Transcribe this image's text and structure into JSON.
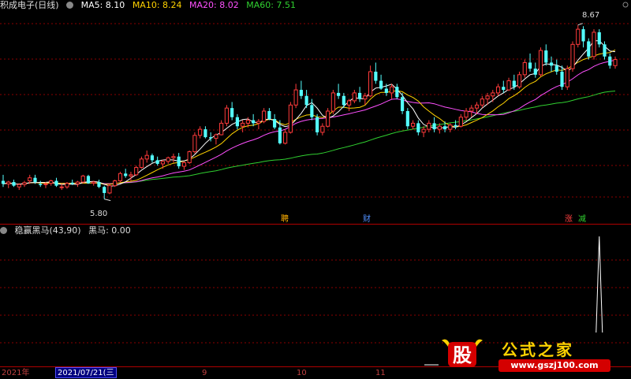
{
  "header": {
    "title": "积成电子(日线)",
    "ma5": "MA5: 8.10",
    "ma10": "MA10: 8.24",
    "ma20": "MA20: 8.02",
    "ma60": "MA60: 7.51"
  },
  "sub_header": {
    "title": "稳赢黑马(43,90)",
    "value": "黑马: 0.00"
  },
  "annotations": {
    "high": "8.67",
    "low": "5.80",
    "tag_1": "聘",
    "tag_2": "财",
    "tag_3": "涨",
    "tag_4": "减"
  },
  "x_axis": {
    "year": "2021年",
    "selected_date": "2021/07/21(三",
    "month_9": "9",
    "month_10": "10",
    "month_11": "11"
  },
  "watermark": {
    "logo_char": "股",
    "text": "公式之家",
    "url": "www.gszj100.com"
  },
  "colors": {
    "up": "#ff3b3b",
    "down": "#54ffff",
    "ma5": "#ffffff",
    "ma10": "#ffd200",
    "ma20": "#ff50ff",
    "ma60": "#30d030",
    "grid": "#8b0000",
    "indicator": "#ffffff"
  },
  "chart_data": {
    "type": "candlestick",
    "title": "积成电子(日线)",
    "ylim": [
      5.6,
      8.9
    ],
    "high_label": 8.67,
    "low_label": 5.8,
    "ohlc": [
      [
        6.1,
        6.2,
        6.0,
        6.05
      ],
      [
        6.05,
        6.1,
        5.98,
        6.08
      ],
      [
        6.08,
        6.12,
        6.0,
        6.02
      ],
      [
        6.0,
        6.06,
        5.95,
        6.04
      ],
      [
        6.04,
        6.1,
        6.0,
        6.07
      ],
      [
        6.1,
        6.2,
        6.05,
        6.15
      ],
      [
        6.15,
        6.2,
        6.05,
        6.08
      ],
      [
        6.05,
        6.1,
        6.0,
        6.03
      ],
      [
        6.04,
        6.08,
        5.98,
        6.05
      ],
      [
        6.06,
        6.12,
        6.02,
        6.1
      ],
      [
        6.1,
        6.15,
        6.0,
        6.02
      ],
      [
        6.0,
        6.05,
        5.95,
        6.0
      ],
      [
        6.0,
        6.08,
        5.97,
        6.06
      ],
      [
        6.07,
        6.12,
        6.03,
        6.05
      ],
      [
        6.05,
        6.1,
        6.0,
        6.08
      ],
      [
        6.08,
        6.2,
        6.06,
        6.18
      ],
      [
        6.18,
        6.2,
        6.05,
        6.06
      ],
      [
        6.06,
        6.1,
        6.02,
        6.08
      ],
      [
        6.08,
        6.12,
        5.98,
        6.0
      ],
      [
        6.0,
        6.02,
        5.8,
        5.9
      ],
      [
        5.9,
        6.05,
        5.88,
        6.02
      ],
      [
        6.02,
        6.12,
        6.0,
        6.1
      ],
      [
        6.1,
        6.25,
        6.08,
        6.22
      ],
      [
        6.22,
        6.3,
        6.15,
        6.18
      ],
      [
        6.18,
        6.25,
        6.1,
        6.2
      ],
      [
        6.2,
        6.35,
        6.18,
        6.32
      ],
      [
        6.32,
        6.5,
        6.3,
        6.46
      ],
      [
        6.46,
        6.6,
        6.4,
        6.52
      ],
      [
        6.52,
        6.55,
        6.4,
        6.44
      ],
      [
        6.44,
        6.5,
        6.35,
        6.38
      ],
      [
        6.38,
        6.45,
        6.3,
        6.42
      ],
      [
        6.42,
        6.5,
        6.38,
        6.48
      ],
      [
        6.48,
        6.55,
        6.4,
        6.5
      ],
      [
        6.5,
        6.56,
        6.3,
        6.34
      ],
      [
        6.34,
        6.42,
        6.28,
        6.4
      ],
      [
        6.4,
        6.6,
        6.38,
        6.58
      ],
      [
        6.58,
        6.9,
        6.55,
        6.85
      ],
      [
        6.85,
        7.0,
        6.8,
        6.95
      ],
      [
        6.95,
        7.0,
        6.8,
        6.82
      ],
      [
        6.82,
        6.9,
        6.75,
        6.8
      ],
      [
        6.8,
        6.88,
        6.7,
        6.86
      ],
      [
        6.86,
        7.1,
        6.85,
        7.05
      ],
      [
        7.05,
        7.35,
        7.0,
        7.3
      ],
      [
        7.3,
        7.4,
        7.1,
        7.15
      ],
      [
        7.15,
        7.2,
        6.95,
        7.0
      ],
      [
        7.0,
        7.1,
        6.9,
        7.05
      ],
      [
        7.05,
        7.15,
        6.98,
        7.1
      ],
      [
        7.1,
        7.2,
        7.0,
        7.05
      ],
      [
        7.05,
        7.12,
        6.95,
        7.08
      ],
      [
        7.08,
        7.3,
        7.05,
        7.25
      ],
      [
        7.25,
        7.3,
        7.1,
        7.12
      ],
      [
        7.12,
        7.2,
        6.95,
        6.98
      ],
      [
        6.98,
        7.1,
        6.7,
        6.72
      ],
      [
        6.72,
        6.95,
        6.7,
        6.9
      ],
      [
        6.9,
        7.4,
        6.88,
        7.35
      ],
      [
        7.35,
        7.7,
        7.3,
        7.6
      ],
      [
        7.6,
        7.75,
        7.45,
        7.5
      ],
      [
        7.5,
        7.6,
        7.3,
        7.35
      ],
      [
        7.35,
        7.45,
        7.1,
        7.15
      ],
      [
        7.15,
        7.2,
        6.85,
        6.9
      ],
      [
        6.9,
        7.05,
        6.85,
        7.0
      ],
      [
        7.0,
        7.3,
        6.98,
        7.25
      ],
      [
        7.25,
        7.6,
        7.2,
        7.55
      ],
      [
        7.55,
        7.7,
        7.45,
        7.5
      ],
      [
        7.5,
        7.55,
        7.3,
        7.35
      ],
      [
        7.35,
        7.45,
        7.25,
        7.42
      ],
      [
        7.42,
        7.6,
        7.38,
        7.55
      ],
      [
        7.55,
        7.65,
        7.4,
        7.45
      ],
      [
        7.45,
        7.55,
        7.35,
        7.5
      ],
      [
        7.5,
        8.0,
        7.48,
        7.9
      ],
      [
        7.9,
        8.05,
        7.7,
        7.75
      ],
      [
        7.75,
        7.85,
        7.6,
        7.62
      ],
      [
        7.62,
        7.7,
        7.5,
        7.55
      ],
      [
        7.55,
        7.7,
        7.45,
        7.65
      ],
      [
        7.65,
        7.7,
        7.45,
        7.48
      ],
      [
        7.48,
        7.55,
        7.2,
        7.25
      ],
      [
        7.25,
        7.3,
        6.95,
        7.0
      ],
      [
        7.0,
        7.1,
        6.95,
        7.05
      ],
      [
        7.05,
        7.1,
        6.85,
        6.9
      ],
      [
        6.9,
        7.0,
        6.82,
        6.95
      ],
      [
        6.95,
        7.1,
        6.9,
        7.05
      ],
      [
        7.05,
        7.15,
        6.9,
        6.95
      ],
      [
        6.95,
        7.05,
        6.88,
        7.0
      ],
      [
        7.0,
        7.08,
        6.9,
        6.95
      ],
      [
        6.95,
        7.05,
        6.9,
        7.02
      ],
      [
        7.02,
        7.1,
        6.95,
        7.0
      ],
      [
        7.0,
        7.2,
        6.98,
        7.15
      ],
      [
        7.15,
        7.3,
        7.1,
        7.25
      ],
      [
        7.25,
        7.35,
        7.15,
        7.3
      ],
      [
        7.3,
        7.4,
        7.2,
        7.35
      ],
      [
        7.35,
        7.5,
        7.3,
        7.45
      ],
      [
        7.45,
        7.55,
        7.35,
        7.5
      ],
      [
        7.5,
        7.6,
        7.4,
        7.55
      ],
      [
        7.55,
        7.7,
        7.5,
        7.65
      ],
      [
        7.65,
        7.75,
        7.55,
        7.6
      ],
      [
        7.6,
        7.8,
        7.58,
        7.75
      ],
      [
        7.75,
        7.85,
        7.6,
        7.65
      ],
      [
        7.65,
        7.9,
        7.62,
        7.85
      ],
      [
        7.85,
        8.1,
        7.8,
        8.05
      ],
      [
        8.05,
        8.2,
        7.9,
        7.95
      ],
      [
        7.95,
        8.05,
        7.8,
        7.85
      ],
      [
        7.85,
        8.3,
        7.82,
        8.25
      ],
      [
        8.25,
        8.35,
        8.0,
        8.05
      ],
      [
        8.05,
        8.15,
        7.9,
        8.0
      ],
      [
        8.0,
        8.1,
        7.85,
        7.9
      ],
      [
        7.9,
        8.0,
        7.6,
        7.65
      ],
      [
        7.65,
        8.0,
        7.6,
        7.95
      ],
      [
        7.95,
        8.4,
        7.9,
        8.35
      ],
      [
        8.35,
        8.67,
        8.3,
        8.6
      ],
      [
        8.6,
        8.65,
        8.3,
        8.4
      ],
      [
        8.4,
        8.45,
        8.1,
        8.15
      ],
      [
        8.15,
        8.6,
        8.1,
        8.55
      ],
      [
        8.55,
        8.6,
        8.3,
        8.35
      ],
      [
        8.35,
        8.4,
        8.1,
        8.15
      ],
      [
        8.15,
        8.2,
        7.95,
        8.0
      ],
      [
        8.0,
        8.15,
        7.95,
        8.1
      ]
    ],
    "indicator": {
      "name": "稳赢黑马(43,90)",
      "value": 0.0,
      "spike_index": 112,
      "spike_value": 1.0
    }
  }
}
